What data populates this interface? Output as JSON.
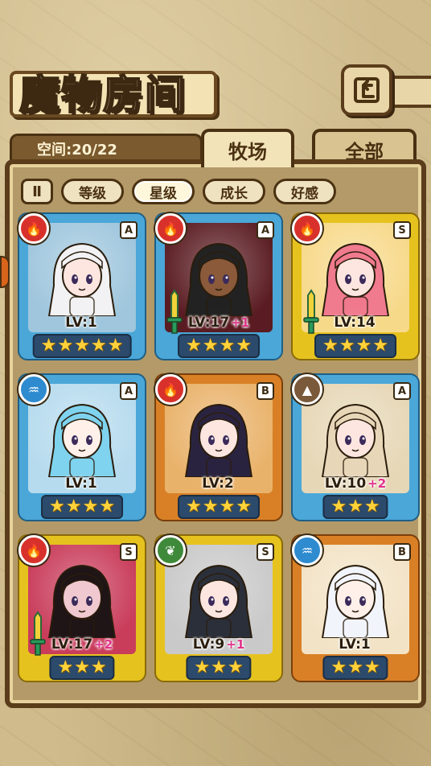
{
  "screen": {
    "title": "魔物房间",
    "capacity": "空间:20/22"
  },
  "tabs": [
    {
      "label": "牧场",
      "active": true
    },
    {
      "label": "全部",
      "active": false
    }
  ],
  "sort": {
    "toggle_label": "Ⅱ",
    "buttons": [
      {
        "label": "等级",
        "active": false
      },
      {
        "label": "星级",
        "active": true
      },
      {
        "label": "成长",
        "active": false
      },
      {
        "label": "好感",
        "active": false
      }
    ]
  },
  "colors": {
    "fire": "#d8312b",
    "water": "#2f8bd0",
    "earth": "#7a5a3a",
    "wind": "#3f8a3a",
    "frame_blue": "#4aa7d8",
    "frame_gold": "#e6c21e",
    "frame_orange": "#d98026"
  },
  "monsters": [
    {
      "element": "fire",
      "element_icon": "flame-icon",
      "rank": "A",
      "level": "LV:1",
      "plus": "",
      "stars": 5,
      "frame": "blue",
      "weapon": false,
      "hair": "#f2f2f4",
      "skin": "#fde6e0",
      "bg": "#9fc6dd"
    },
    {
      "element": "fire",
      "element_icon": "flame-icon",
      "rank": "A",
      "level": "LV:17",
      "plus": "+1",
      "stars": 4,
      "frame": "blue",
      "weapon": true,
      "hair": "#222",
      "skin": "#8a5a3a",
      "bg": "#5a1c22"
    },
    {
      "element": "fire",
      "element_icon": "flame-icon",
      "rank": "S",
      "level": "LV:14",
      "plus": "",
      "stars": 4,
      "frame": "gold",
      "weapon": true,
      "hair": "#f07a8e",
      "skin": "#fde6e0",
      "bg": "#f7d98a"
    },
    {
      "element": "water",
      "element_icon": "water-icon",
      "rank": "A",
      "level": "LV:1",
      "plus": "",
      "stars": 4,
      "frame": "blue",
      "weapon": false,
      "hair": "#7fd3ee",
      "skin": "#fff1ea",
      "bg": "#b6dbee"
    },
    {
      "element": "fire",
      "element_icon": "flame-icon",
      "rank": "B",
      "level": "LV:2",
      "plus": "",
      "stars": 4,
      "frame": "orange",
      "weapon": false,
      "hair": "#2a2340",
      "skin": "#fde6e0",
      "bg": "#e9b26a"
    },
    {
      "element": "earth",
      "element_icon": "mountain-icon",
      "rank": "A",
      "level": "LV:10",
      "plus": "+2",
      "stars": 3,
      "frame": "blue",
      "weapon": false,
      "hair": "#e8d6b8",
      "skin": "#fde6e0",
      "bg": "#e6d7b6"
    },
    {
      "element": "fire",
      "element_icon": "flame-icon",
      "rank": "S",
      "level": "LV:17",
      "plus": "+2",
      "stars": 3,
      "frame": "gold",
      "weapon": true,
      "hair": "#1f1416",
      "skin": "#f0c8cf",
      "bg": "#c93c5a"
    },
    {
      "element": "wind",
      "element_icon": "leaf-icon",
      "rank": "S",
      "level": "LV:9",
      "plus": "+1",
      "stars": 3,
      "frame": "gold",
      "weapon": false,
      "hair": "#2b2f3a",
      "skin": "#fde6e0",
      "bg": "#c9c9c9"
    },
    {
      "element": "water",
      "element_icon": "water-icon",
      "rank": "B",
      "level": "LV:1",
      "plus": "",
      "stars": 3,
      "frame": "orange",
      "weapon": false,
      "hair": "#f2f4fb",
      "skin": "#fff1ea",
      "bg": "#f3e3c6"
    }
  ]
}
